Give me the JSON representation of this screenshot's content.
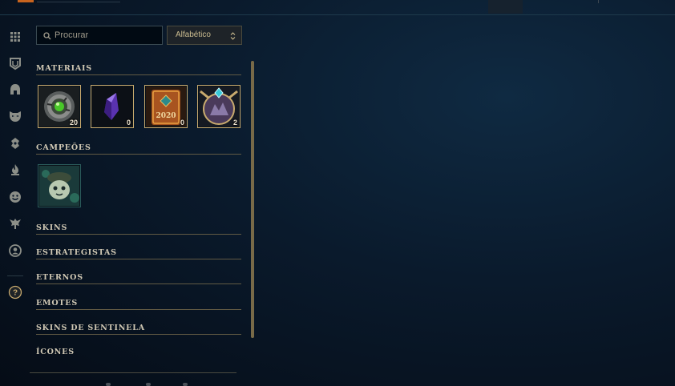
{
  "search": {
    "placeholder": "Procurar",
    "value": ""
  },
  "sort": {
    "selected": "Alfabético"
  },
  "side_nav": {
    "items": [
      "grid-icon",
      "emblem-icon",
      "champion-helmet-icon",
      "skin-mask-icon",
      "ward-icon",
      "eternal-flame-icon",
      "emote-face-icon",
      "tactician-icon",
      "profile-icon",
      "help-icon"
    ],
    "help_glyph": "?"
  },
  "sections": {
    "materials": {
      "title": "MATERIAIS",
      "items": [
        {
          "icon": "hextech-orb-icon",
          "count": "20"
        },
        {
          "icon": "purple-essence-gem-icon",
          "count": "0"
        },
        {
          "icon": "2020-token-icon",
          "label": "2020",
          "count": "0"
        },
        {
          "icon": "mythic-chest-icon",
          "count": "2"
        }
      ]
    },
    "champions": {
      "title": "CAMPEÕES",
      "items": [
        {
          "icon": "champion-portrait-icon"
        }
      ]
    },
    "skins": {
      "title": "SKINS"
    },
    "tacticians": {
      "title": "ESTRATEGISTAS"
    },
    "eternals": {
      "title": "ETERNOS"
    },
    "emotes": {
      "title": "EMOTES"
    },
    "ward_skins": {
      "title": "SKINS DE SENTINELA"
    },
    "icons": {
      "title": "ÍCONES"
    }
  },
  "colors": {
    "gold": "#c8aa6e",
    "text": "#d0c8b4",
    "background": "#0a1a2c"
  }
}
